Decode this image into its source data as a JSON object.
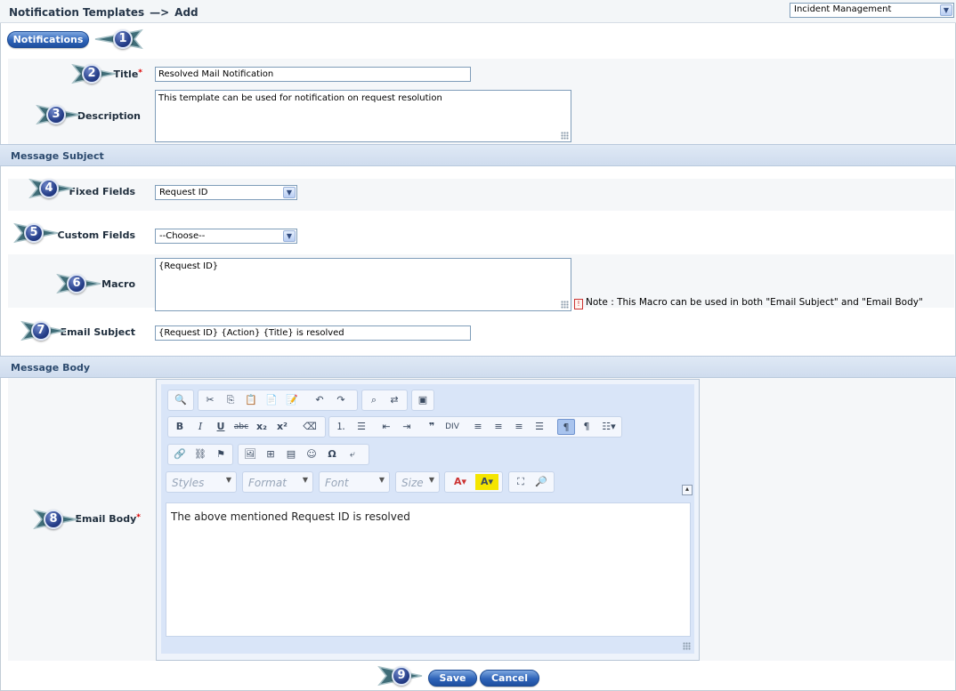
{
  "header": {
    "title": "Notification Templates",
    "arrow": "—>",
    "action": "Add",
    "module_select": "Incident Management"
  },
  "top_button": {
    "label": "Notifications"
  },
  "badges": [
    "1",
    "2",
    "3",
    "4",
    "5",
    "6",
    "7",
    "8",
    "9"
  ],
  "form": {
    "title_label": "Title",
    "title_value": "Resolved Mail Notification",
    "description_label": "Description",
    "description_value": "This template can be used for notification on request resolution",
    "section_subject": "Message Subject",
    "fixed_fields_label": "Fixed Fields",
    "fixed_fields_value": "Request ID",
    "custom_fields_label": "Custom Fields",
    "custom_fields_value": "--Choose--",
    "macro_label": "Macro",
    "macro_value": "{Request ID}",
    "macro_note": "Note : This Macro can be used in both \"Email Subject\" and \"Email Body\"",
    "email_subject_label": "Email Subject",
    "email_subject_value": "{Request ID} {Action} {Title} is resolved",
    "section_body": "Message Body",
    "email_body_label": "Email Body",
    "required_mark": "*"
  },
  "editor": {
    "styles": "Styles",
    "format": "Format",
    "font": "Font",
    "size": "Size",
    "content": "The above mentioned Request ID is resolved"
  },
  "actions": {
    "save": "Save",
    "cancel": "Cancel"
  },
  "colors": {
    "accent": "#2e63b8",
    "section_bg": "#d7e3f2",
    "badge": "#27408a"
  }
}
